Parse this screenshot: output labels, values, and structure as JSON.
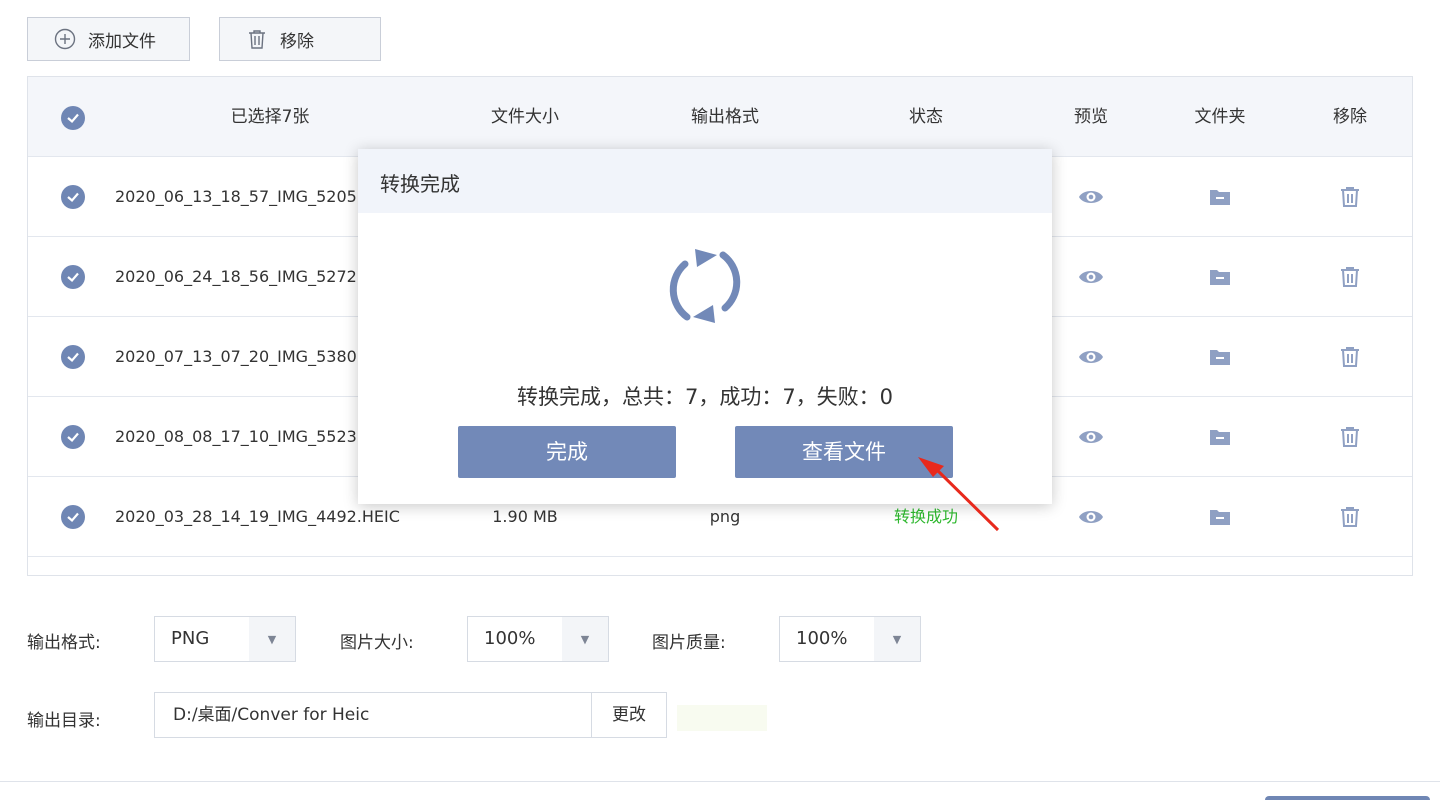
{
  "toolbar": {
    "add_label": "添加文件",
    "remove_label": "移除"
  },
  "table": {
    "headers": {
      "name": "已选择7张",
      "size": "文件大小",
      "format": "输出格式",
      "status": "状态",
      "preview": "预览",
      "folder": "文件夹",
      "remove": "移除"
    },
    "rows": [
      {
        "name": "2020_06_13_18_57_IMG_5205",
        "size": "",
        "format": "",
        "status": ""
      },
      {
        "name": "2020_06_24_18_56_IMG_5272",
        "size": "",
        "format": "",
        "status": ""
      },
      {
        "name": "2020_07_13_07_20_IMG_5380",
        "size": "",
        "format": "",
        "status": ""
      },
      {
        "name": "2020_08_08_17_10_IMG_5523",
        "size": "",
        "format": "",
        "status": ""
      },
      {
        "name": "2020_03_28_14_19_IMG_4492.HEIC",
        "size": "1.90 MB",
        "format": "png",
        "status": "转换成功"
      }
    ]
  },
  "settings": {
    "format_label": "输出格式:",
    "format_value": "PNG",
    "size_label": "图片大小:",
    "size_value": "100%",
    "quality_label": "图片质量:",
    "quality_value": "100%",
    "dir_label": "输出目录:",
    "dir_value": "D:/桌面/Conver for Heic",
    "change_label": "更改"
  },
  "dialog": {
    "title": "转换完成",
    "message": "转换完成，总共：7，成功：7，失败：0",
    "done_label": "完成",
    "view_label": "查看文件"
  },
  "colors": {
    "accent": "#7289b8",
    "success": "#2eb82e",
    "pointer": "#e8291c"
  },
  "icons": {
    "add": "plus-circle-icon",
    "remove": "trash-icon",
    "check": "check-circle-icon",
    "preview": "eye-icon",
    "folder": "folder-icon",
    "refresh": "refresh-icon",
    "dropdown": "caret-down-icon"
  }
}
